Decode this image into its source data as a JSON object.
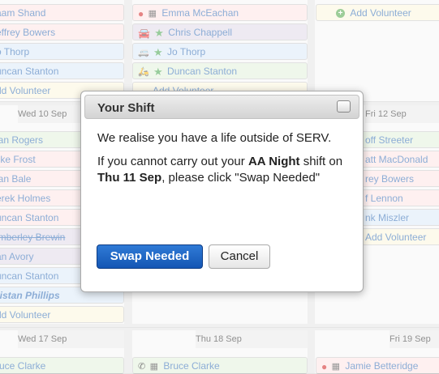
{
  "week1": {
    "col1": {
      "cells": [
        {
          "text": "aam Shand"
        },
        {
          "text": "effrey Bowers"
        },
        {
          "text": "o Thorp"
        },
        {
          "text": "uncan Stanton"
        },
        {
          "text": "dd Volunteer"
        }
      ]
    },
    "col2": {
      "cells": [
        {
          "text": "Emma McEachan"
        },
        {
          "text": "Chris Chappell"
        },
        {
          "text": "Jo Thorp"
        },
        {
          "text": "Duncan Stanton"
        },
        {
          "text": "Add Volunteer"
        }
      ]
    },
    "col3": {
      "add": "Add Volunteer"
    }
  },
  "week2": {
    "headers": [
      "Wed 10 Sep",
      "Fri 12 Sep"
    ],
    "col1": [
      "lan Rogers",
      "like Frost",
      "lan Bale",
      "erek Holmes",
      "uncan Stanton",
      "imberley Brewin",
      "an Avory",
      "uncan Stanton",
      "ristan Phillips",
      "dd Volunteer"
    ],
    "col3": [
      "off Streeter",
      "att MacDonald",
      "rey Bowers",
      "f Lennon",
      "nk Miszler",
      "Add Volunteer"
    ]
  },
  "week3": {
    "headers": [
      "Wed 17 Sep",
      "Thu 18 Sep",
      "Fri 19 Sep"
    ],
    "cells": [
      "ruce Clarke",
      "Bruce Clarke",
      "Jamie Betteridge"
    ]
  },
  "dialog": {
    "title": "Your Shift",
    "line1": "We realise you have a life outside of SERV.",
    "line2_a": "If you cannot carry out your ",
    "line2_shift": "AA Night",
    "line2_b": " shift on ",
    "line2_date": "Thu 11 Sep",
    "line2_c": ", please click \"Swap Needed\"",
    "primary_button": "Swap Needed",
    "cancel_button": "Cancel"
  }
}
